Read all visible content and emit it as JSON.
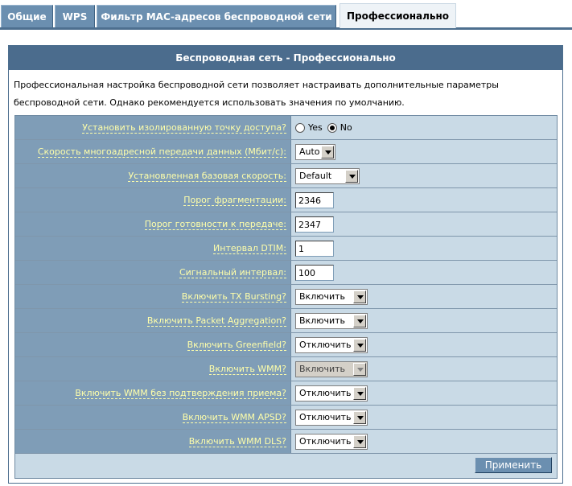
{
  "tabs": [
    {
      "label": "Общие",
      "active": false
    },
    {
      "label": "WPS",
      "active": false
    },
    {
      "label": "Фильтр MAC-адресов беспроводной сети",
      "active": false
    },
    {
      "label": "Профессионально",
      "active": true
    }
  ],
  "panel": {
    "title": "Беспроводная сеть - Профессионально",
    "description": "Профессиональная настройка беспроводной сети позволяет настраивать дополнительные параметры беспроводной сети. Однако рекомендуется использовать значения по умолчанию."
  },
  "rows": {
    "isolated_ap": {
      "label": "Установить изолированную точку доступа?",
      "options": [
        "Yes",
        "No"
      ],
      "selected": "No"
    },
    "multicast_rate": {
      "label": "Скорость многоадресной передачи данных (Мбит/с):",
      "value": "Auto"
    },
    "basic_rate": {
      "label": "Установленная базовая скорость:",
      "value": "Default"
    },
    "frag_threshold": {
      "label": "Порог фрагментации:",
      "value": "2346"
    },
    "rts_threshold": {
      "label": "Порог готовности к передаче:",
      "value": "2347"
    },
    "dtim": {
      "label": "Интервал DTIM:",
      "value": "1"
    },
    "beacon": {
      "label": "Сигнальный интервал:",
      "value": "100"
    },
    "tx_bursting": {
      "label": "Включить TX Bursting?",
      "value": "Включить"
    },
    "packet_aggregation": {
      "label": "Включить Packet Aggregation?",
      "value": "Включить"
    },
    "greenfield": {
      "label": "Включить Greenfield?",
      "value": "Отключить"
    },
    "wmm": {
      "label": "Включить WMM?",
      "value": "Включить",
      "disabled": true
    },
    "wmm_noack": {
      "label": "Включить WMM без подтверждения приема?",
      "value": "Отключить"
    },
    "wmm_apsd": {
      "label": "Включить WMM APSD?",
      "value": "Отключить"
    },
    "wmm_dls": {
      "label": "Включить WMM DLS?",
      "value": "Отключить"
    }
  },
  "apply_label": "Применить"
}
